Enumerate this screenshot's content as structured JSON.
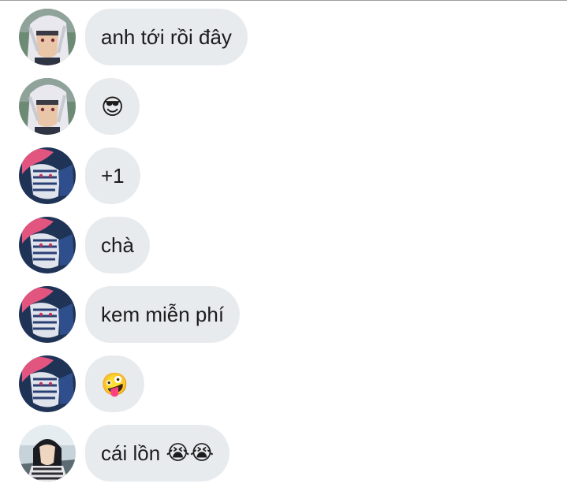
{
  "messages": [
    {
      "avatar": "white-hair-character-avatar",
      "text": "anh tới rồi đây",
      "emoji": ""
    },
    {
      "avatar": "white-hair-character-avatar",
      "text": "",
      "emoji": "😎"
    },
    {
      "avatar": "pink-hair-character-avatar",
      "text": "+1",
      "emoji": ""
    },
    {
      "avatar": "pink-hair-character-avatar",
      "text": "chà",
      "emoji": ""
    },
    {
      "avatar": "pink-hair-character-avatar",
      "text": "kem miễn phí",
      "emoji": ""
    },
    {
      "avatar": "pink-hair-character-avatar",
      "text": "",
      "emoji": "🤪"
    },
    {
      "avatar": "dark-hair-character-avatar",
      "text": "cái lồn ",
      "emoji": "😭😭"
    }
  ],
  "colors": {
    "bubble_bg": "#e8ebee",
    "text": "#1c1c1c",
    "top_border": "#9e9e9e"
  }
}
